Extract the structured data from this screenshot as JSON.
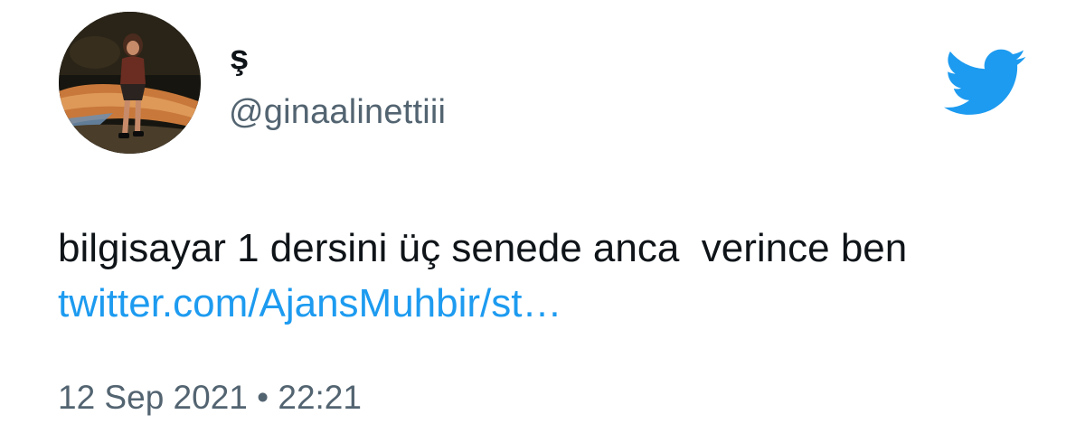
{
  "tweet": {
    "author": {
      "display_name": "ş",
      "handle": "@ginaalinettiii",
      "avatar_icon": "profile-photo"
    },
    "text": "bilgisayar 1 dersini üç senede anca  verince ben",
    "link_text": "twitter.com/AjansMuhbir/st…",
    "timestamp": "12 Sep 2021 • 22:21"
  },
  "brand": {
    "logo_icon": "twitter-bird-icon",
    "accent_color": "#1d9bf0",
    "text_color": "#0f1419",
    "muted_color": "#536471"
  }
}
